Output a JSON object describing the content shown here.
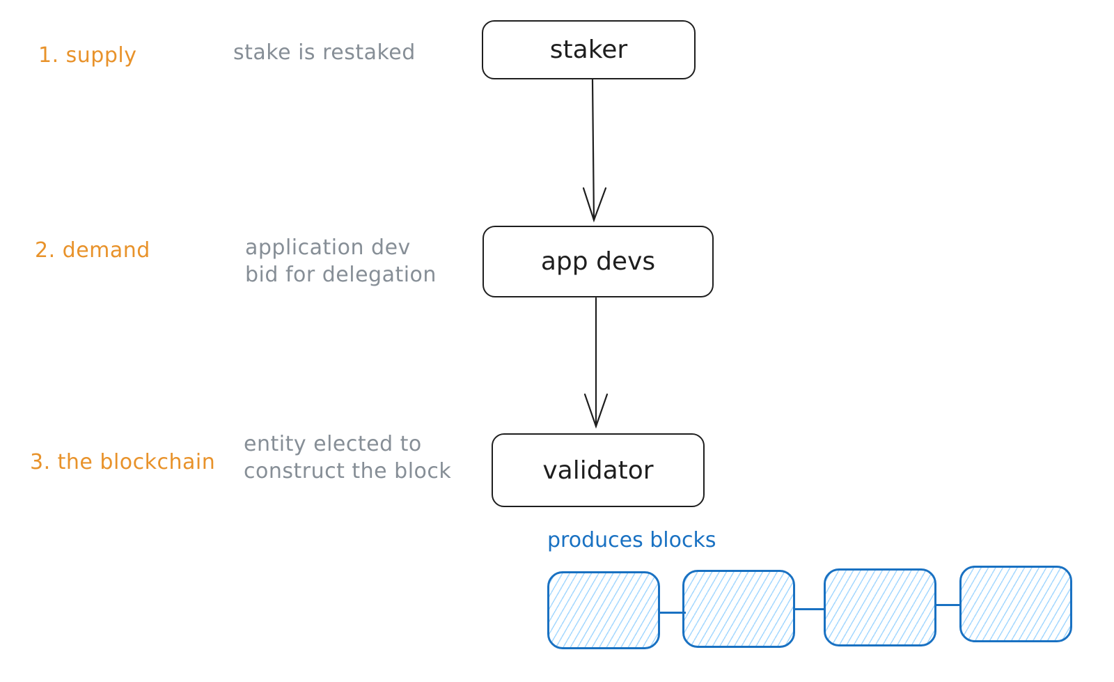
{
  "stages": [
    {
      "label": "1. supply",
      "description": [
        "stake is restaked"
      ]
    },
    {
      "label": "2. demand",
      "description": [
        "application dev",
        "bid for delegation"
      ]
    },
    {
      "label": "3. the blockchain",
      "description": [
        "entity elected to",
        "construct the block"
      ]
    }
  ],
  "nodes": [
    {
      "label": "staker"
    },
    {
      "label": "app devs"
    },
    {
      "label": "validator"
    }
  ],
  "edges": [
    {
      "from": "staker",
      "to": "app devs"
    },
    {
      "from": "app devs",
      "to": "validator"
    }
  ],
  "blocks": {
    "caption": "produces blocks",
    "count": 4,
    "color": "#1971c2"
  },
  "colors": {
    "stage": "#e8922a",
    "description": "#868e96",
    "node_stroke": "#1e1e1e"
  }
}
